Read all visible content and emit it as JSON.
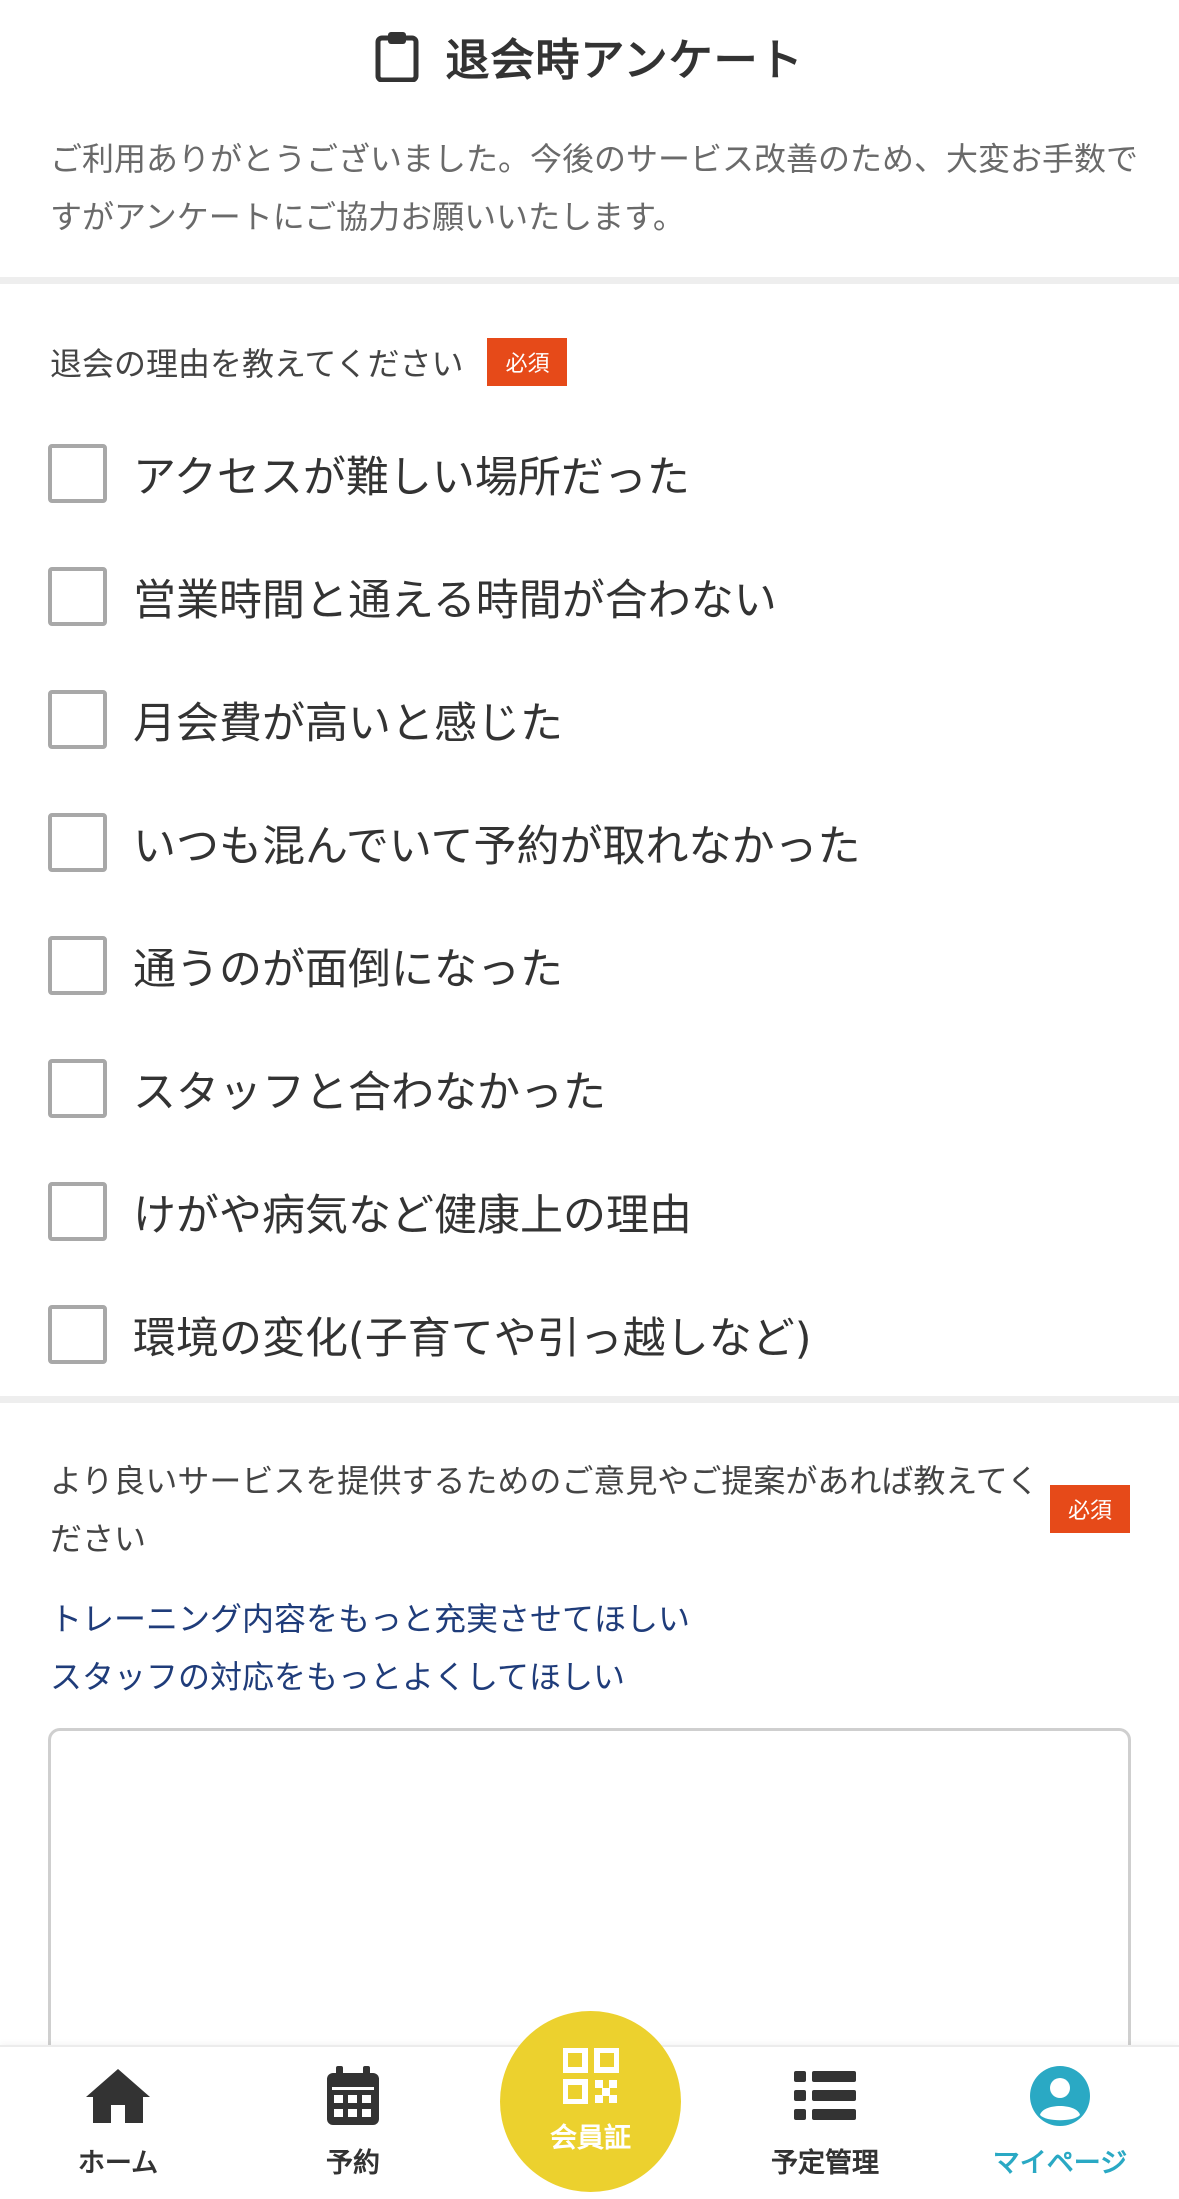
{
  "header": {
    "title": "退会時アンケート",
    "icon": "clipboard-icon"
  },
  "intro": "ご利用ありがとうございました。今後のサービス改善のため、大変お手数ですがアンケートにご協力お願いいたします。",
  "question1": {
    "label": "退会の理由を教えてください",
    "required_badge": "必須",
    "options": [
      "アクセスが難しい場所だった",
      "営業時間と通える時間が合わない",
      "月会費が高いと感じた",
      "いつも混んでいて予約が取れなかった",
      "通うのが面倒になった",
      "スタッフと合わなかった",
      "けがや病気など健康上の理由",
      "環境の変化(子育てや引っ越しなど)"
    ]
  },
  "question2": {
    "label": "より良いサービスを提供するためのご意見やご提案があれば教えてください",
    "required_badge": "必須",
    "suggestions": [
      "トレーニング内容をもっと充実させてほしい",
      "スタッフの対応をもっとよくしてほしい"
    ],
    "textarea_value": ""
  },
  "bottom_nav": {
    "items": [
      {
        "label": "ホーム",
        "icon": "home-icon"
      },
      {
        "label": "予約",
        "icon": "calendar-icon"
      },
      {
        "label": "予定管理",
        "icon": "list-icon"
      },
      {
        "label": "マイページ",
        "icon": "user-icon"
      }
    ],
    "member_card": {
      "label": "会員証",
      "icon": "qr-code-icon"
    },
    "active": "マイページ"
  },
  "colors": {
    "required": "#e64a19",
    "link": "#1f3c7a",
    "active_nav": "#2aa9c4",
    "member_fab": "#ecd12e"
  }
}
